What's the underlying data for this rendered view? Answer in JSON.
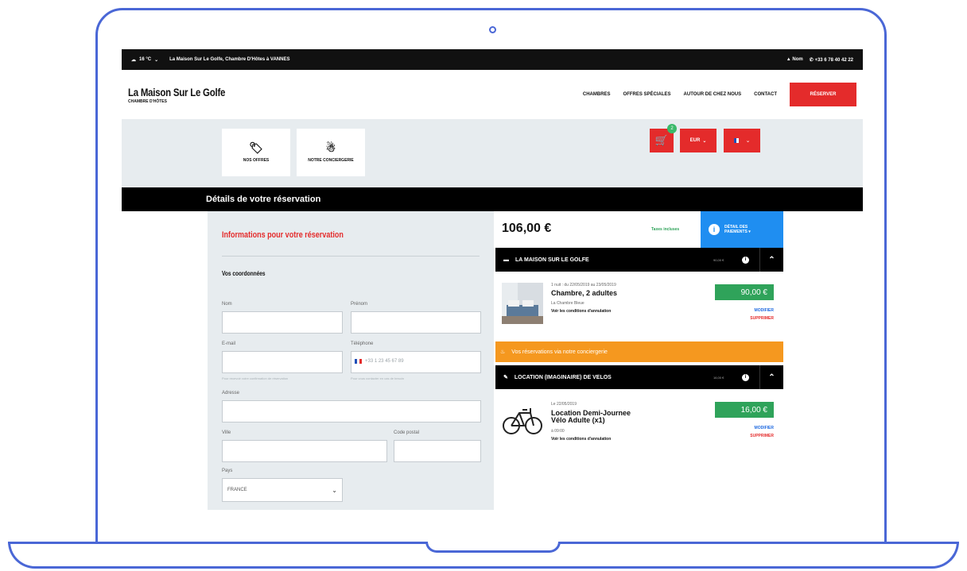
{
  "topbar": {
    "weather": "16 °C",
    "tagline": "La Maison Sur Le Golfe, Chambre D'Hôtes à VANNES",
    "login": "Nom",
    "phone": "+33 6 78 40 42 22"
  },
  "header": {
    "brand": "La Maison Sur Le Golfe",
    "brand_sub": "CHAMBRE D'HÔTES",
    "nav": [
      "CHAMBRES",
      "OFFRES SPÉCIALES",
      "AUTOUR DE CHEZ NOUS",
      "CONTACT"
    ],
    "reserve": "RÉSERVER"
  },
  "toolbar": {
    "tile1": "NOS OFFRES",
    "tile2": "NOTRE CONCIERGERIE",
    "cart_count": "2",
    "currency": "EUR"
  },
  "page_title": "Détails de votre réservation",
  "form": {
    "title": "Informations pour votre réservation",
    "section": "Vos coordonnées",
    "nom": "Nom",
    "prenom": "Prénom",
    "email": "E-mail",
    "email_hint": "Pour recevoir votre confirmation de réservation",
    "telephone": "Téléphone",
    "telephone_placeholder": "+33 1 23 45 67 89",
    "telephone_hint": "Pour vous contacter en cas de besoin",
    "adresse": "Adresse",
    "ville": "Ville",
    "code_postal": "Code postal",
    "pays": "Pays",
    "pays_value": "FRANCE"
  },
  "summary": {
    "total": "106,00 €",
    "taxes": "Taxes incluses",
    "detail_line1": "DÉTAIL DES",
    "detail_line2": "PAIEMENTS ▾",
    "section1": {
      "title": "LA MAISON SUR LE GOLFE",
      "amount": "90,00 €",
      "dates": "1 nuit : du 22/05/2019 au 23/05/2019",
      "name": "Chambre, 2 adultes",
      "sub": "La Chambre Bleue",
      "conditions": "Voir les conditions d'annulation",
      "price": "90,00 €",
      "modify": "MODIFIER",
      "delete": "SUPPRIMER"
    },
    "concierge": "Vos réservations via notre conciergerie",
    "section2": {
      "title": "LOCATION (IMAGINAIRE) DE VELOS",
      "amount": "16,00 €",
      "date": "Le 22/05/2019",
      "name_line1": "Location Demi-Journee",
      "name_line2": "Vélo Adulte (x1)",
      "time": "à 09:00",
      "conditions": "Voir les conditions d'annulation",
      "price": "16,00 €",
      "modify": "MODIFIER",
      "delete": "SUPPRIMER"
    }
  }
}
